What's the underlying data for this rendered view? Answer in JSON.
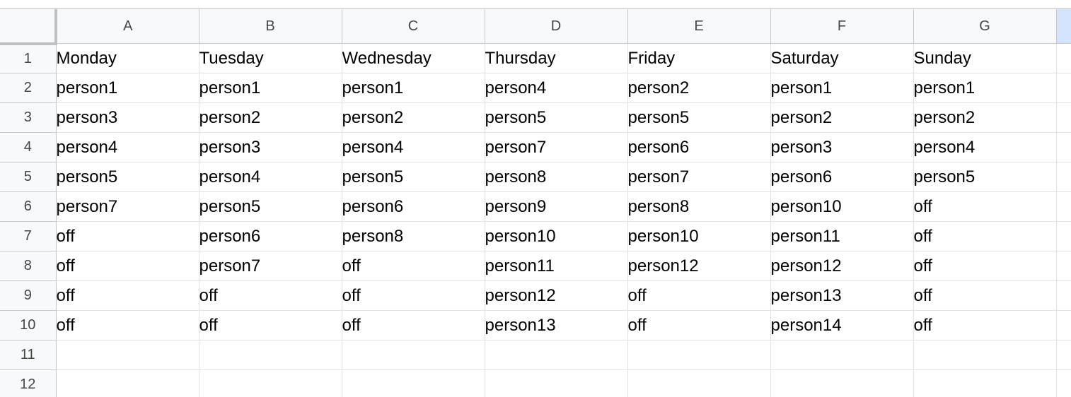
{
  "columns": [
    "A",
    "B",
    "C",
    "D",
    "E",
    "F",
    "G"
  ],
  "rows": [
    {
      "num": "1",
      "cells": [
        "Monday",
        "Tuesday",
        "Wednesday",
        "Thursday",
        "Friday",
        "Saturday",
        "Sunday"
      ]
    },
    {
      "num": "2",
      "cells": [
        "person1",
        "person1",
        "person1",
        "person4",
        "person2",
        "person1",
        "person1"
      ]
    },
    {
      "num": "3",
      "cells": [
        "person3",
        "person2",
        "person2",
        "person5",
        "person5",
        "person2",
        "person2"
      ]
    },
    {
      "num": "4",
      "cells": [
        "person4",
        "person3",
        "person4",
        "person7",
        "person6",
        "person3",
        "person4"
      ]
    },
    {
      "num": "5",
      "cells": [
        "person5",
        "person4",
        "person5",
        "person8",
        "person7",
        "person6",
        "person5"
      ]
    },
    {
      "num": "6",
      "cells": [
        "person7",
        "person5",
        "person6",
        "person9",
        "person8",
        "person10",
        "off"
      ]
    },
    {
      "num": "7",
      "cells": [
        "off",
        "person6",
        "person8",
        "person10",
        "person10",
        "person11",
        "off"
      ]
    },
    {
      "num": "8",
      "cells": [
        "off",
        "person7",
        "off",
        "person11",
        "person12",
        "person12",
        "off"
      ]
    },
    {
      "num": "9",
      "cells": [
        "off",
        "off",
        "off",
        "person12",
        "off",
        "person13",
        "off"
      ]
    },
    {
      "num": "10",
      "cells": [
        "off",
        "off",
        "off",
        "person13",
        "off",
        "person14",
        "off"
      ]
    },
    {
      "num": "11",
      "cells": [
        "",
        "",
        "",
        "",
        "",
        "",
        ""
      ]
    },
    {
      "num": "12",
      "cells": [
        "",
        "",
        "",
        "",
        "",
        "",
        ""
      ]
    }
  ]
}
